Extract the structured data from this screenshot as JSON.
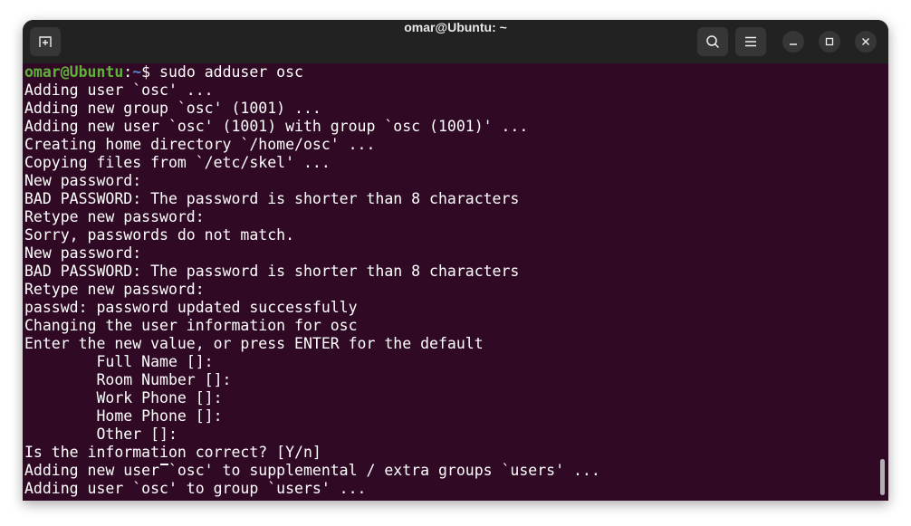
{
  "window": {
    "title": "omar@Ubuntu: ~"
  },
  "toolbar": {
    "new_tab_icon": "new-tab-icon",
    "search_icon": "search-icon",
    "menu_icon": "hamburger-menu-icon",
    "minimize_icon": "minimize-icon",
    "maximize_icon": "maximize-icon",
    "close_icon": "close-icon"
  },
  "terminal": {
    "prompt_user": "omar@Ubuntu",
    "prompt_sep": ":",
    "prompt_path": "~",
    "prompt_symbol": "$ ",
    "command": "sudo adduser osc",
    "lines": [
      "Adding user `osc' ...",
      "Adding new group `osc' (1001) ...",
      "Adding new user `osc' (1001) with group `osc (1001)' ...",
      "Creating home directory `/home/osc' ...",
      "Copying files from `/etc/skel' ...",
      "New password:",
      "BAD PASSWORD: The password is shorter than 8 characters",
      "Retype new password:",
      "Sorry, passwords do not match.",
      "New password:",
      "BAD PASSWORD: The password is shorter than 8 characters",
      "Retype new password:",
      "passwd: password updated successfully",
      "Changing the user information for osc",
      "Enter the new value, or press ENTER for the default",
      "        Full Name []:",
      "        Room Number []:",
      "        Work Phone []:",
      "        Home Phone []:",
      "        Other []:",
      "Is the information correct? [Y/n]",
      "Adding new user `osc' to supplemental / extra groups `users' ...",
      "Adding user `osc' to group `users' ..."
    ]
  }
}
